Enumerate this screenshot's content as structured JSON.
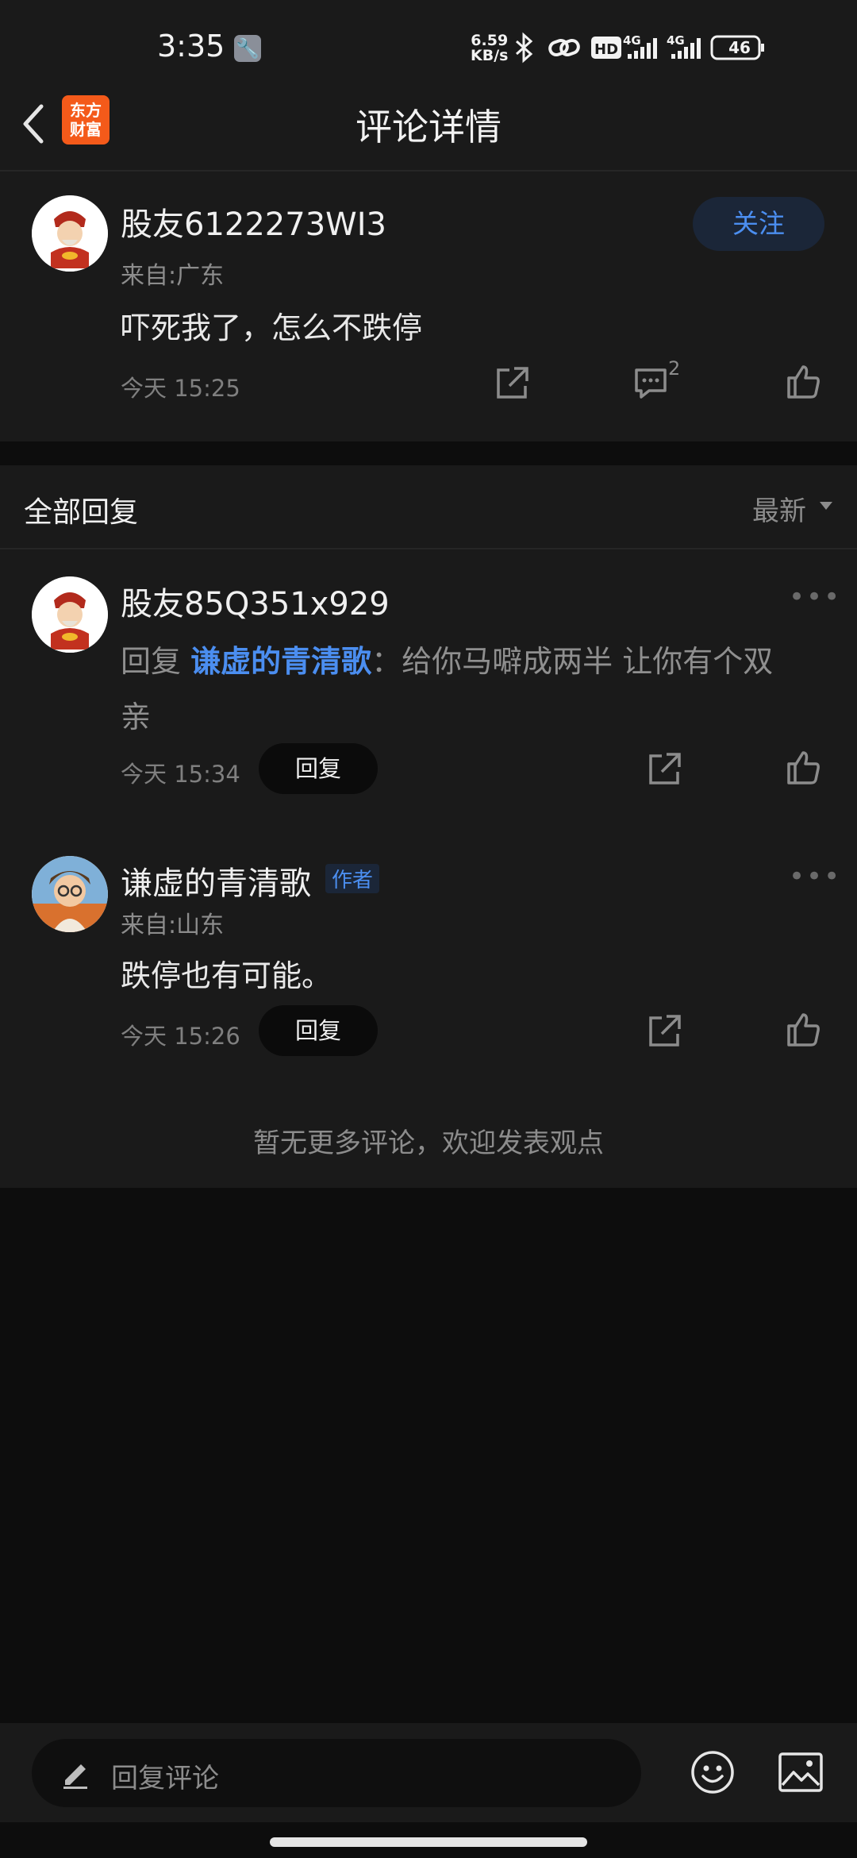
{
  "status_bar": {
    "time": "3:35",
    "net_speed_value": "6.59",
    "net_speed_unit": "KB/s",
    "network_left": "4G",
    "network_right": "4G",
    "hd": "HD",
    "battery": "46"
  },
  "header": {
    "logo_line1": "东方",
    "logo_line2": "财富",
    "title": "评论详情"
  },
  "post": {
    "username": "股友6122273WI3",
    "location": "来自:广东",
    "content": "吓死我了，怎么不跌停",
    "time": "今天 15:25",
    "comment_count": "2",
    "follow_label": "关注"
  },
  "replies_header": {
    "label": "全部回复",
    "sort_label": "最新"
  },
  "replies": [
    {
      "username": "股友85Q351x929",
      "reply_prefix": "回复 ",
      "reply_to": "谦虚的青清歌",
      "content_line1": "：给你马噼成两半 让你有个双",
      "content_line2": "亲",
      "time": "今天 15:34",
      "reply_button": "回复"
    },
    {
      "username": "谦虚的青清歌",
      "badge": "作者",
      "location": "来自:山东",
      "content": "跌停也有可能。",
      "time": "今天 15:26",
      "reply_button": "回复"
    }
  ],
  "no_more_text": "暂无更多评论，欢迎发表观点",
  "composer": {
    "placeholder": "回复评论"
  },
  "colors": {
    "accent": "#4b8ef0",
    "background": "#0d0d0d",
    "card": "#1a1a1a",
    "logo": "#f45a1a"
  }
}
